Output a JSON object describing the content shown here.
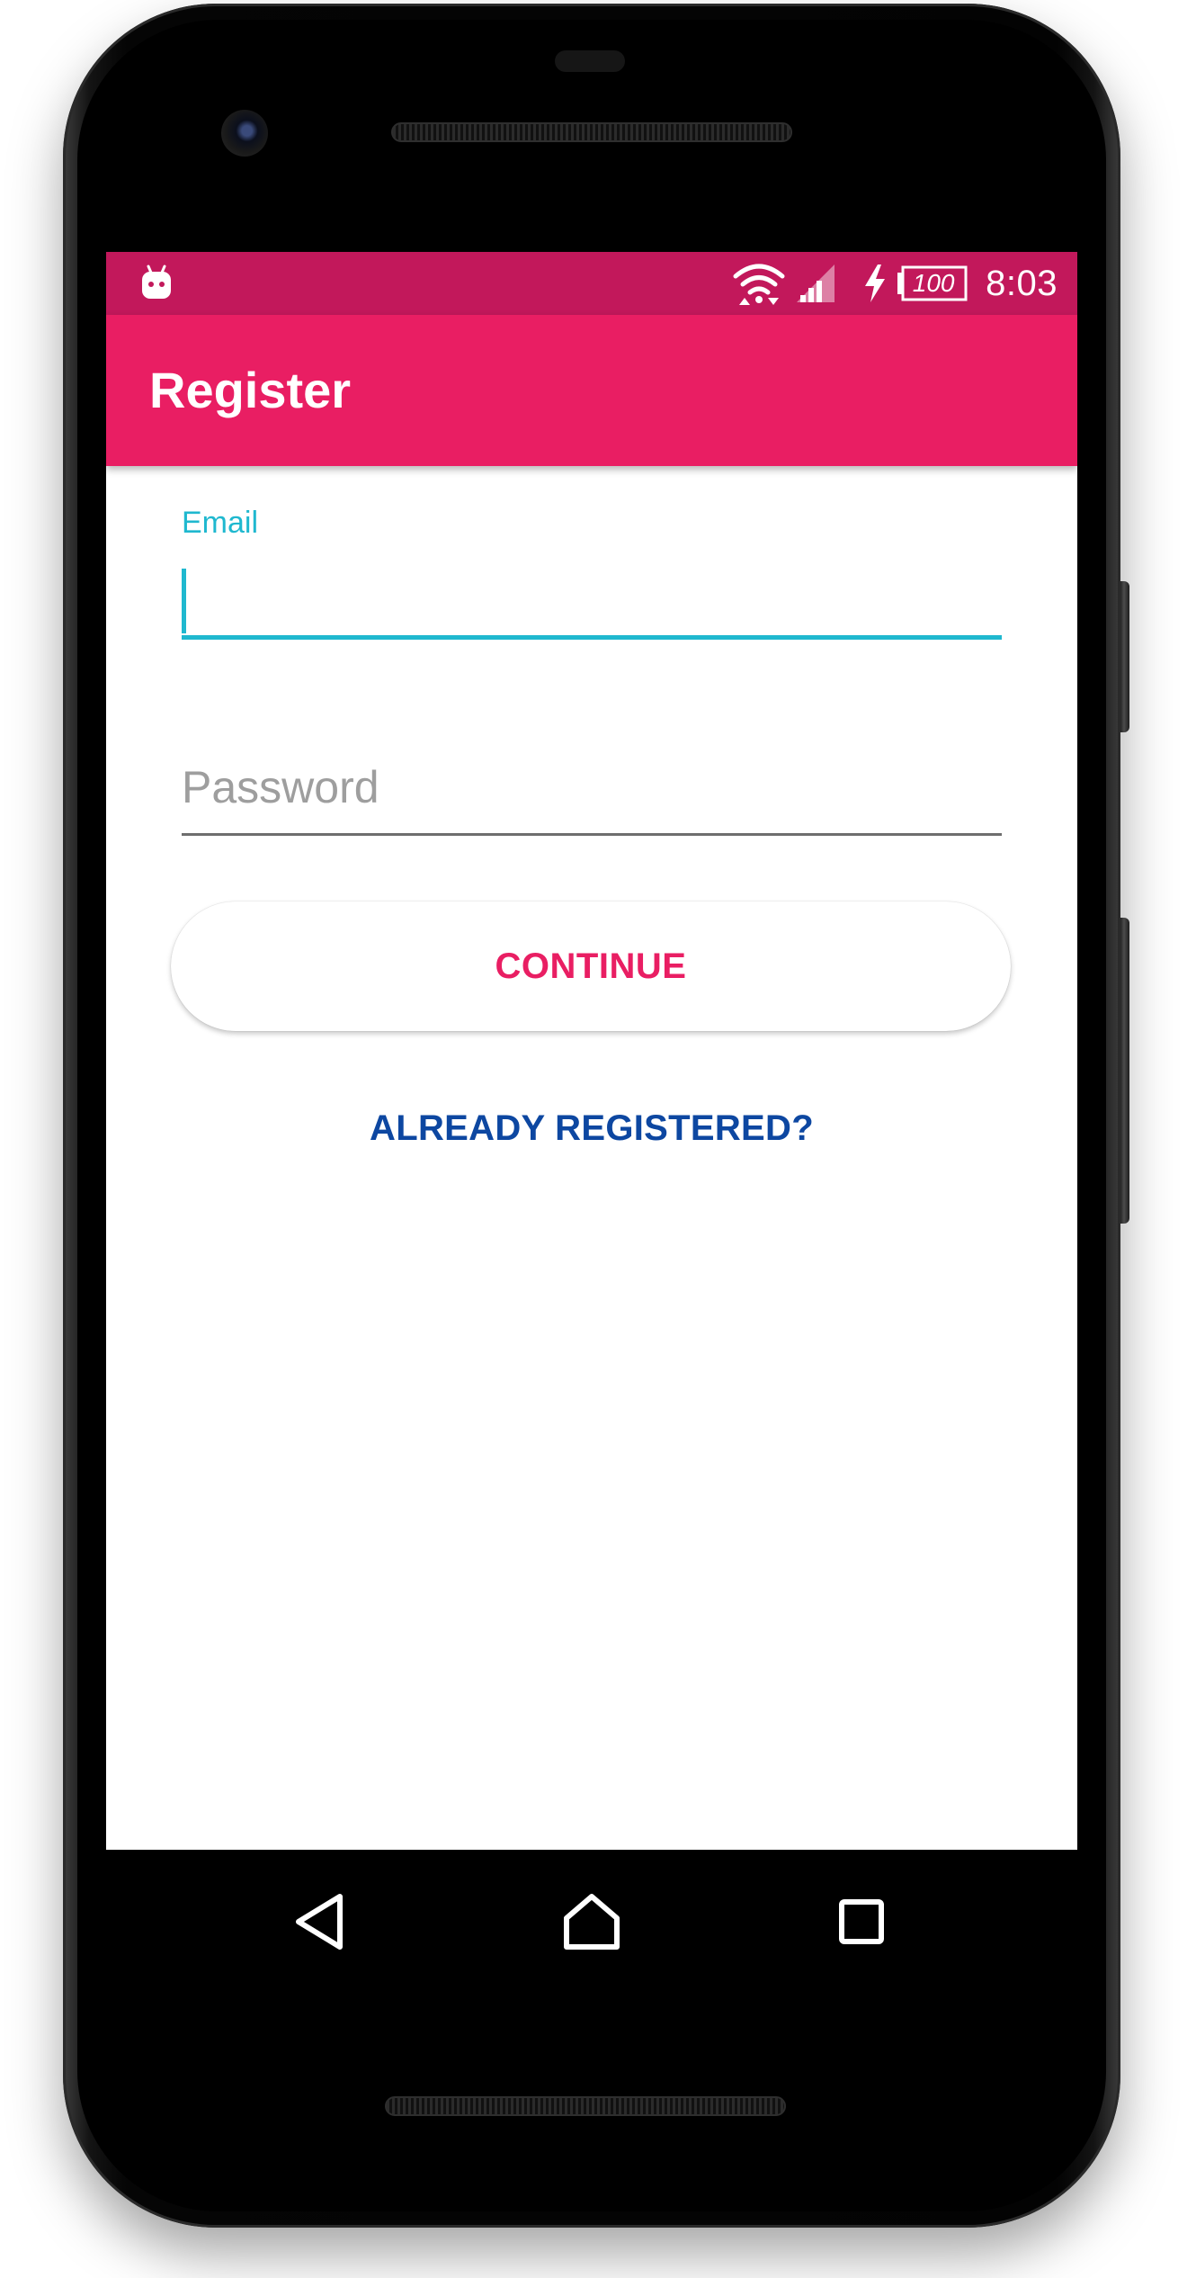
{
  "status_bar": {
    "time": "8:03",
    "battery_level": "100"
  },
  "app_bar": {
    "title": "Register"
  },
  "form": {
    "email_label": "Email",
    "email_value": "",
    "password_placeholder": "Password",
    "password_value": ""
  },
  "actions": {
    "continue_label": "CONTINUE",
    "already_registered_label": "ALREADY REGISTERED?"
  },
  "icons": {
    "status": [
      "android-notification-icon",
      "wifi-icon",
      "signal-icon",
      "charging-icon",
      "battery-icon"
    ],
    "navigation": [
      "back-icon",
      "home-icon",
      "recent-apps-icon"
    ]
  },
  "colors": {
    "status_bar": "#c2185b",
    "app_bar": "#e91e63",
    "accent": "#1fb8cf",
    "link": "#0d47a1",
    "button_text": "#e91e63"
  }
}
